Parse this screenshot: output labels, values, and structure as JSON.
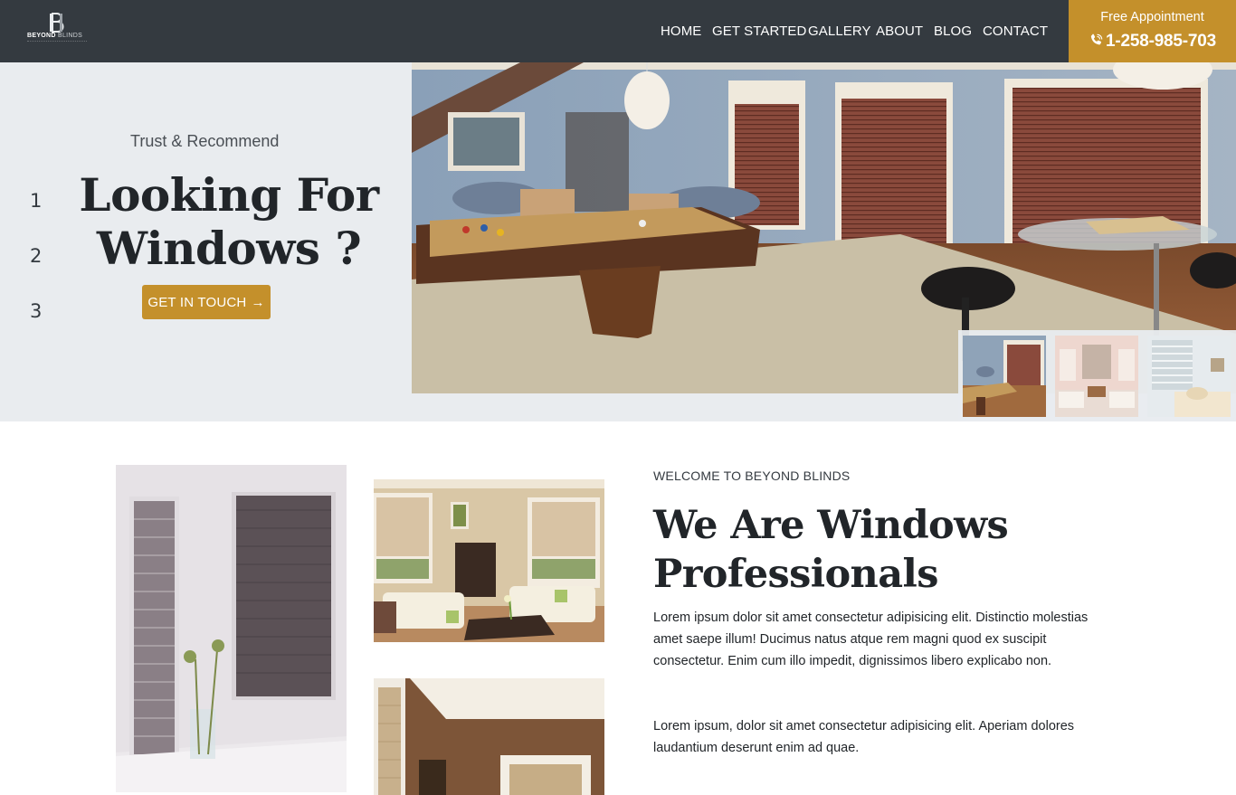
{
  "header": {
    "logo": {
      "brand_bold": "BEYOND",
      "brand_light": "BLINDS"
    },
    "nav": [
      {
        "label": "HOME"
      },
      {
        "label": "GET STARTED"
      },
      {
        "label": "GALLERY"
      },
      {
        "label": "ABOUT"
      },
      {
        "label": "BLOG"
      },
      {
        "label": "CONTACT"
      }
    ],
    "appointment": {
      "label": "Free Appointment",
      "phone": "1-258-985-703"
    }
  },
  "hero": {
    "pager": [
      "1",
      "2",
      "3"
    ],
    "kicker": "Trust & Recommend",
    "title_line1": "Looking For",
    "title_line2": "Windows ?",
    "cta_label": "GET IN TOUCH",
    "cta_arrow": "→",
    "thumbnails": [
      {
        "icon": "billiard-room-thumbnail"
      },
      {
        "icon": "living-room-thumbnail"
      },
      {
        "icon": "sofa-room-thumbnail"
      }
    ]
  },
  "about": {
    "kicker": "WELCOME TO BEYOND BLINDS",
    "title_line1": "We Are Windows",
    "title_line2": "Professionals",
    "paragraph1": "Lorem ipsum dolor sit amet consectetur adipisicing elit. Distinctio molestias amet saepe illum! Ducimus natus atque rem magni quod ex suscipit consectetur. Enim cum illo impedit, dignissimos libero explicabo non.",
    "paragraph2": "Lorem ipsum, dolor sit amet consectetur adipisicing elit. Aperiam dolores laudantium deserunt enim ad quae."
  },
  "colors": {
    "header_bg": "#343a40",
    "accent": "#c4902b",
    "hero_bg": "#e9ecef"
  }
}
